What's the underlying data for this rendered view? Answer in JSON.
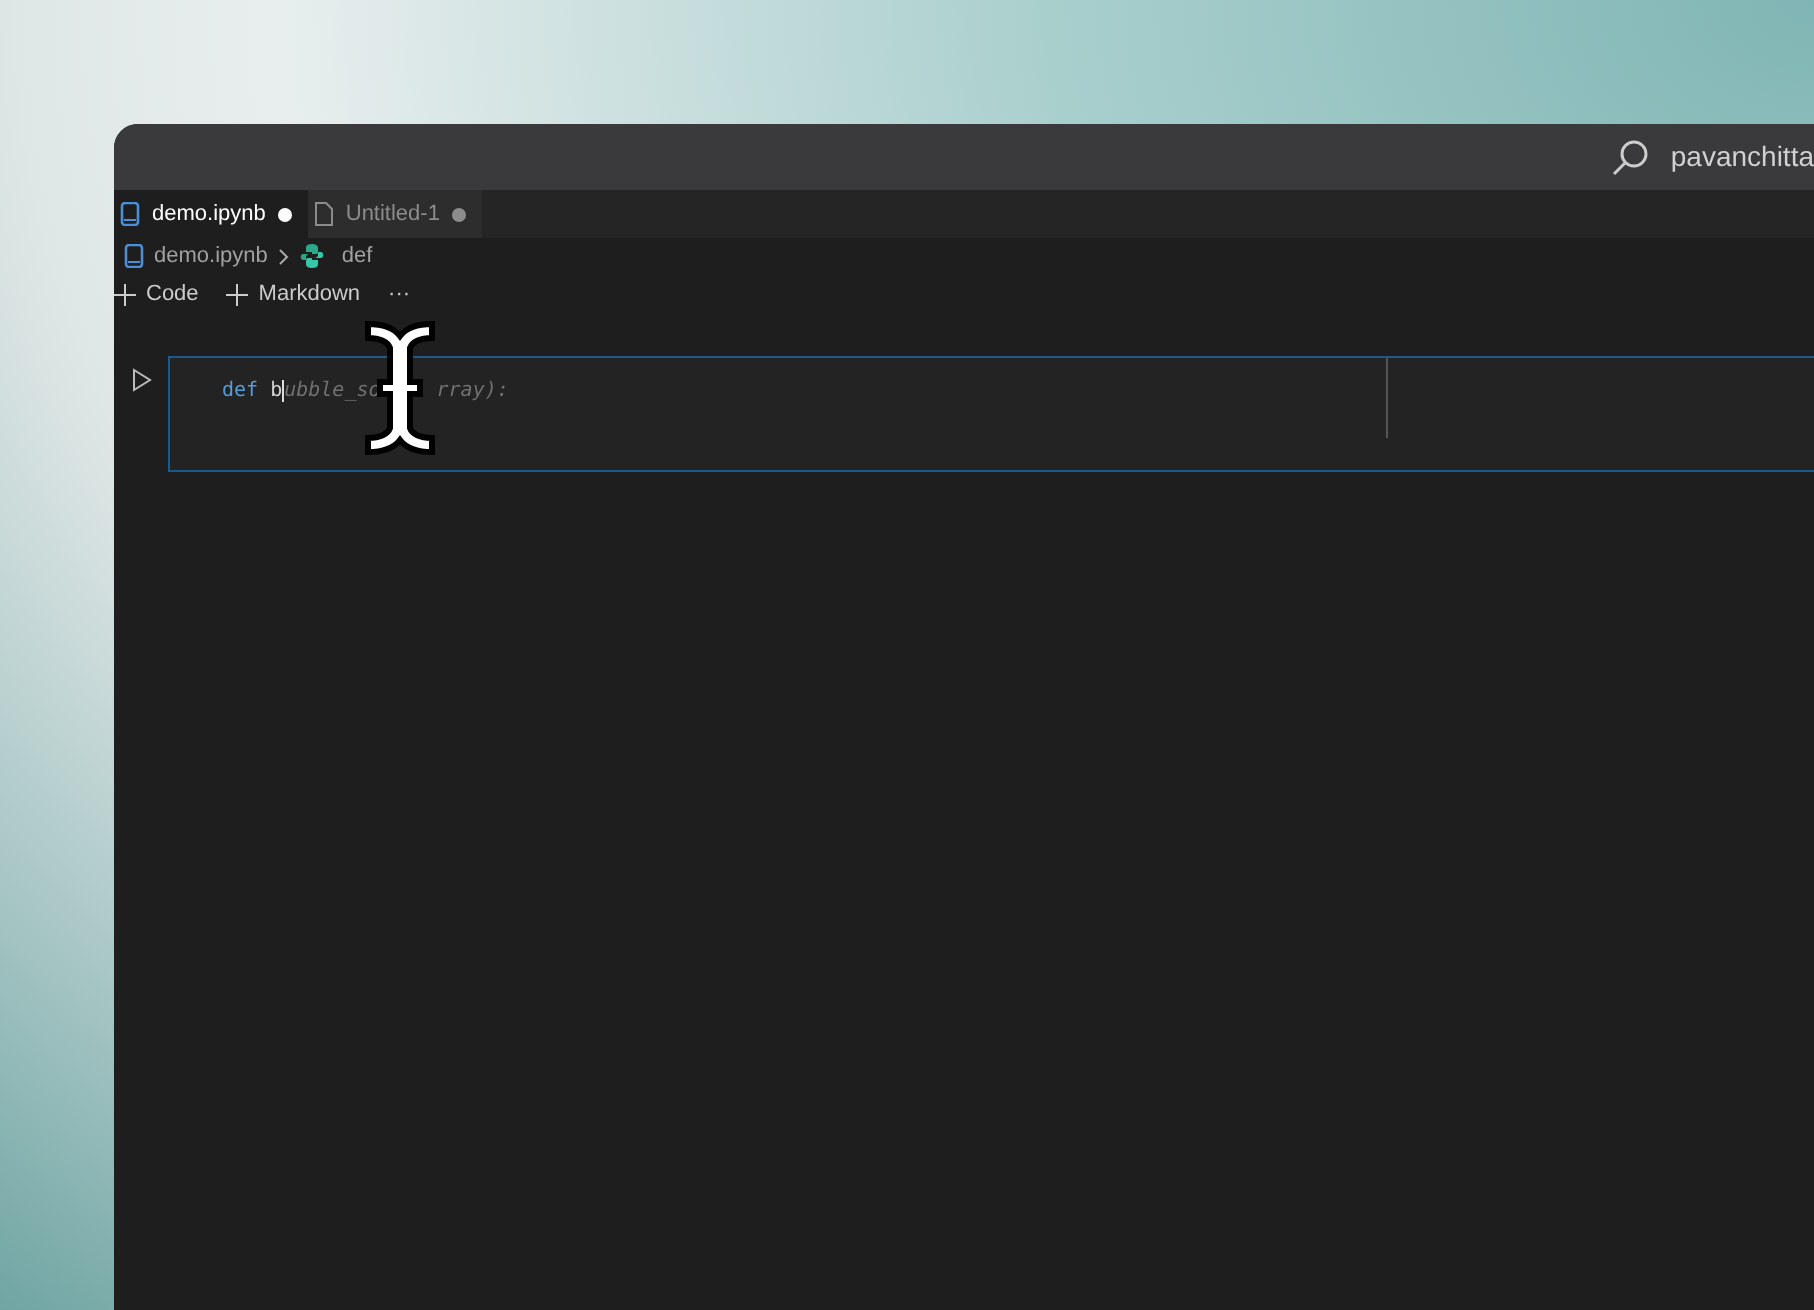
{
  "title_bar": {
    "search_text": "pavanchitta"
  },
  "tabs": [
    {
      "label": "demo.ipynb",
      "selected": true,
      "kind": "notebook",
      "dirty": true
    },
    {
      "label": "Untitled-1",
      "selected": false,
      "kind": "file",
      "dirty": true
    }
  ],
  "breadcrumb": [
    {
      "label": "demo.ipynb",
      "kind": "notebook"
    },
    {
      "label": "def",
      "kind": "python"
    }
  ],
  "toolbar": [
    {
      "label": "Code",
      "kind": "add"
    },
    {
      "label": "Markdown",
      "kind": "add"
    },
    {
      "label": "···",
      "kind": "more"
    }
  ],
  "cells": [
    {
      "focused": true,
      "code": [
        {
          "text": "def",
          "kind": "keyword"
        },
        {
          "text": "b",
          "kind": "typed"
        },
        {
          "text": "ubble_so",
          "kind": "ghost"
        },
        {
          "text": "rray):",
          "kind": "ghost"
        }
      ]
    }
  ]
}
